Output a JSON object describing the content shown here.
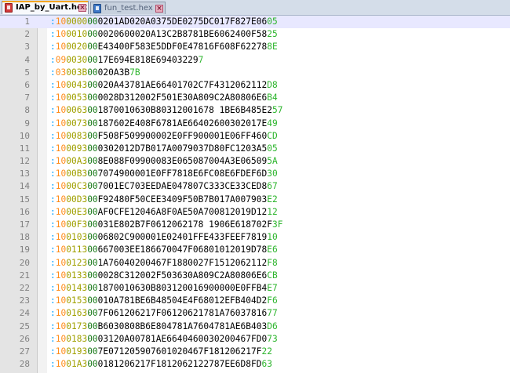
{
  "tabs": [
    {
      "label": "IAP_by_Uart.hex",
      "active": true,
      "icon": "file-icon-red",
      "close": "×"
    },
    {
      "label": "fun_test.hex",
      "active": false,
      "icon": "file-icon-blue",
      "close": "×"
    }
  ],
  "colors": {
    "colon": "#00a0ff",
    "byte_count": "#ff8c1a",
    "address": "#a0a000",
    "record_type": "#1a7a1a",
    "data": "#000000",
    "checksum": "#2db52d",
    "current_line": "#e8e8ff"
  },
  "current_line": 1,
  "lines": [
    {
      "n": "1",
      "colon": ":",
      "bc": "10",
      "addr": "0000",
      "type": "00",
      "data": "0201AD020A0375DE0275DC017F827E06",
      "chk": "05"
    },
    {
      "n": "2",
      "colon": ":",
      "bc": "10",
      "addr": "0010",
      "type": "00",
      "data": "0020600020A13C2B8781BE6062400F58",
      "chk": "25"
    },
    {
      "n": "3",
      "colon": ":",
      "bc": "10",
      "addr": "0020",
      "type": "00",
      "data": "E43400F583E5DDF0E47816F608F62278",
      "chk": "8E"
    },
    {
      "n": "4",
      "colon": ":",
      "bc": "09",
      "addr": "0030",
      "type": "00",
      "data": "17E694E818E69403229",
      "chk": "7"
    },
    {
      "n": "5",
      "colon": ":",
      "bc": "03",
      "addr": "003B",
      "type": "00",
      "data": "020A3B",
      "chk": "7B"
    },
    {
      "n": "6",
      "colon": ":",
      "bc": "10",
      "addr": "0043",
      "type": "00",
      "data": "020A43781AE66401702C7F4312062112",
      "chk": "D8"
    },
    {
      "n": "7",
      "colon": ":",
      "bc": "10",
      "addr": "0053",
      "type": "00",
      "data": "0028D312002F501E30A809C2A80806E6",
      "chk": "B4"
    },
    {
      "n": "8",
      "colon": ":",
      "bc": "10",
      "addr": "0063",
      "type": "00",
      "data": "1870010630B80312001678 1BE6B485E2",
      "chk": "57"
    },
    {
      "n": "9",
      "colon": ":",
      "bc": "10",
      "addr": "0073",
      "type": "00",
      "data": "187602E408F6781AE66402600302017E",
      "chk": "49"
    },
    {
      "n": "10",
      "colon": ":",
      "bc": "10",
      "addr": "0083",
      "type": "00",
      "data": "F508F509900002E0FF900001E06FF460",
      "chk": "CD"
    },
    {
      "n": "11",
      "colon": ":",
      "bc": "10",
      "addr": "0093",
      "type": "00",
      "data": "0302012D7B017A0079037D80FC1203A5",
      "chk": "05"
    },
    {
      "n": "12",
      "colon": ":",
      "bc": "10",
      "addr": "00A3",
      "type": "00",
      "data": "8E088F09900083E065087004A3E06509",
      "chk": "5A"
    },
    {
      "n": "13",
      "colon": ":",
      "bc": "10",
      "addr": "00B3",
      "type": "00",
      "data": "7074900001E0FF7818E6FC08E6FDEF6D",
      "chk": "30"
    },
    {
      "n": "14",
      "colon": ":",
      "bc": "10",
      "addr": "00C3",
      "type": "00",
      "data": "7001EC703EEDAE047807C333CE33CED8",
      "chk": "67"
    },
    {
      "n": "15",
      "colon": ":",
      "bc": "10",
      "addr": "00D3",
      "type": "00",
      "data": "F92480F50CEE3409F50B7B017A007903",
      "chk": "E2"
    },
    {
      "n": "16",
      "colon": ":",
      "bc": "10",
      "addr": "00E3",
      "type": "00",
      "data": "AF0CFE12046A8F0AE50A700812019D12",
      "chk": "12"
    },
    {
      "n": "17",
      "colon": ":",
      "bc": "10",
      "addr": "00F3",
      "type": "00",
      "data": "031E802B7F0612062178 1906E618702F",
      "chk": "3F"
    },
    {
      "n": "18",
      "colon": ":",
      "bc": "10",
      "addr": "0103",
      "type": "00",
      "data": "06802C900001E02401FFE433FEEF7819",
      "chk": "10"
    },
    {
      "n": "19",
      "colon": ":",
      "bc": "10",
      "addr": "0113",
      "type": "00",
      "data": "667003EE186670047F06801012019D78",
      "chk": "E6"
    },
    {
      "n": "20",
      "colon": ":",
      "bc": "10",
      "addr": "0123",
      "type": "00",
      "data": "1A76040200467F1880027F1512062112",
      "chk": "F8"
    },
    {
      "n": "21",
      "colon": ":",
      "bc": "10",
      "addr": "0133",
      "type": "00",
      "data": "0028C312002F503630A809C2A80806E6",
      "chk": "CB"
    },
    {
      "n": "22",
      "colon": ":",
      "bc": "10",
      "addr": "0143",
      "type": "00",
      "data": "1870010630B803120016900000E0FFB4",
      "chk": "E7"
    },
    {
      "n": "23",
      "colon": ":",
      "bc": "10",
      "addr": "0153",
      "type": "00",
      "data": "010A781BE6B48504E4F68012EFB404D2",
      "chk": "F6"
    },
    {
      "n": "24",
      "colon": ":",
      "bc": "10",
      "addr": "0163",
      "type": "00",
      "data": "7F061206217F06120621781A76037816",
      "chk": "77"
    },
    {
      "n": "25",
      "colon": ":",
      "bc": "10",
      "addr": "0173",
      "type": "00",
      "data": "B6030808B6E804781A7604781AE6B403",
      "chk": "D6"
    },
    {
      "n": "26",
      "colon": ":",
      "bc": "10",
      "addr": "0183",
      "type": "00",
      "data": "03120A00781AE6640460030200467FD0",
      "chk": "73"
    },
    {
      "n": "27",
      "colon": ":",
      "bc": "10",
      "addr": "0193",
      "type": "00",
      "data": "7E071205907601020467F181206217F",
      "chk": "22"
    },
    {
      "n": "28",
      "colon": ":",
      "bc": "10",
      "addr": "01A3",
      "type": "00",
      "data": "0181206217F1812062122787EE6D8FD",
      "chk": "63"
    }
  ]
}
